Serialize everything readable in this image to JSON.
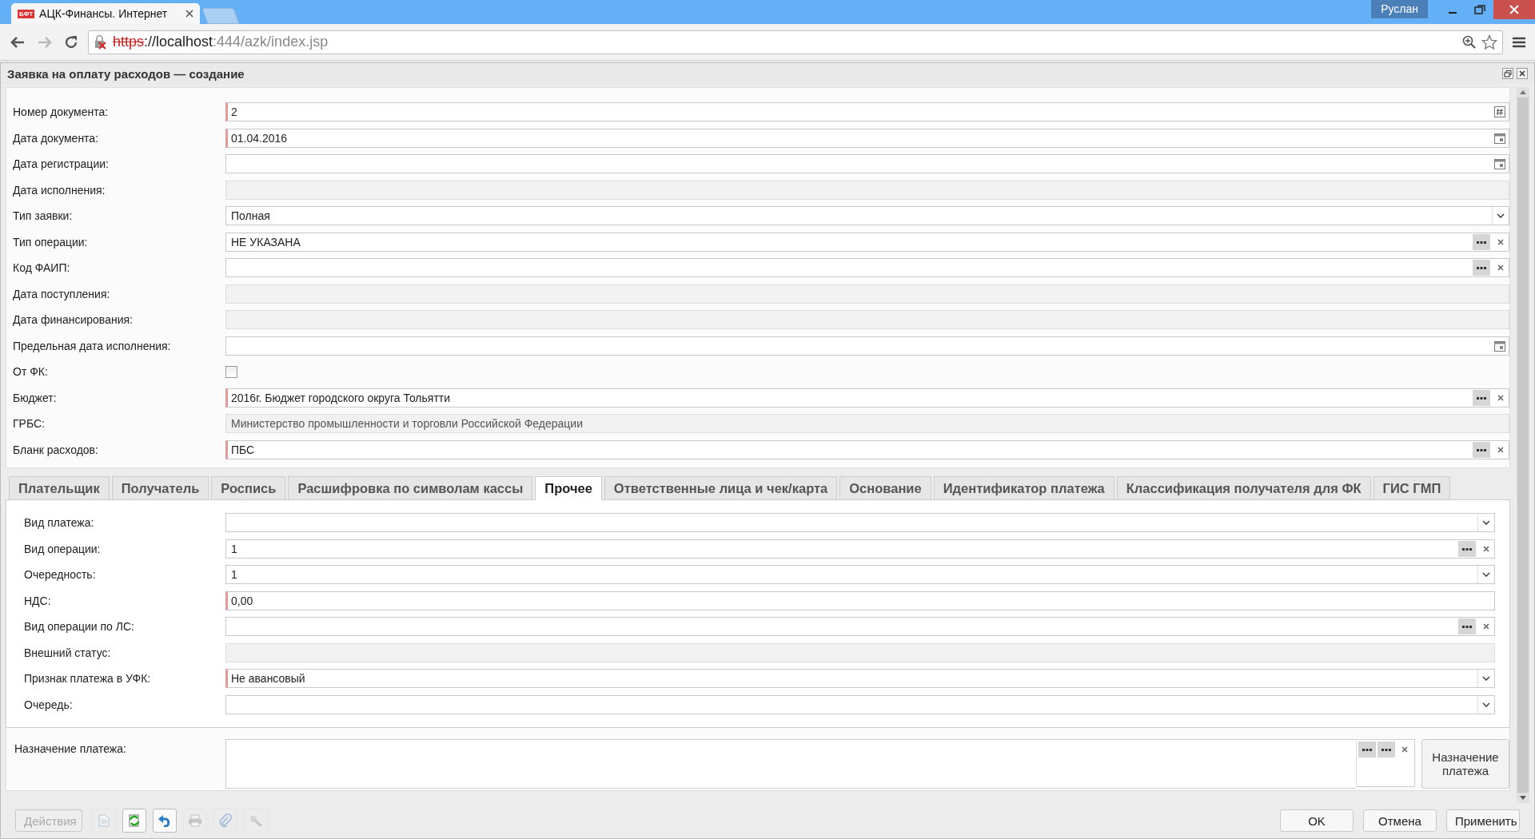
{
  "browser": {
    "tab": {
      "favicon_text": "БФТ",
      "title": "АЦК-Финансы. Интернет"
    },
    "user": "Руслан",
    "url_scheme": "https",
    "url_host": "://localhost",
    "url_path": ":444/azk/index.jsp"
  },
  "window": {
    "title": "Заявка на оплату расходов — создание"
  },
  "form": {
    "fields": [
      {
        "label": "Номер документа:",
        "kind": "number",
        "value": "2",
        "required": true
      },
      {
        "label": "Дата документа:",
        "kind": "date",
        "value": "01.04.2016",
        "required": true
      },
      {
        "label": "Дата регистрации:",
        "kind": "date",
        "required": false
      },
      {
        "label": "Дата исполнения:",
        "kind": "readonly",
        "required": false
      },
      {
        "label": "Тип заявки:",
        "kind": "select",
        "value": "Полная",
        "required": false
      },
      {
        "label": "Тип операции:",
        "kind": "lookup",
        "value": "НЕ УКАЗАНА",
        "required": false
      },
      {
        "label": "Код ФАИП:",
        "kind": "lookup",
        "required": false
      },
      {
        "label": "Дата поступления:",
        "kind": "readonly",
        "required": false
      },
      {
        "label": "Дата финансирования:",
        "kind": "readonly",
        "required": false
      },
      {
        "label": "Предельная дата исполнения:",
        "kind": "date",
        "required": false
      },
      {
        "label": "От ФК:",
        "kind": "checkbox",
        "checked": false
      },
      {
        "label": "Бюджет:",
        "kind": "lookup",
        "value": "2016г. Бюджет городского округа Тольятти",
        "required": true
      },
      {
        "label": "ГРБС:",
        "kind": "readonly",
        "value": "Министерство промышленности и торговли Российской Федерации",
        "required": false
      },
      {
        "label": "Бланк расходов:",
        "kind": "lookup",
        "value": "ПБС",
        "required": true
      }
    ]
  },
  "tabs": [
    {
      "label": "Плательщик",
      "selected": false
    },
    {
      "label": "Получатель",
      "selected": false
    },
    {
      "label": "Роспись",
      "selected": false
    },
    {
      "label": "Расшифровка по символам кассы",
      "selected": false
    },
    {
      "label": "Прочее",
      "selected": true
    },
    {
      "label": "Ответственные лица и чек/карта",
      "selected": false
    },
    {
      "label": "Основание",
      "selected": false
    },
    {
      "label": "Идентификатор платежа",
      "selected": false
    },
    {
      "label": "Классификация получателя для ФК",
      "selected": false
    },
    {
      "label": "ГИС ГМП",
      "selected": false
    }
  ],
  "panel": {
    "fields": [
      {
        "label": "Вид платежа:",
        "kind": "select",
        "required": false
      },
      {
        "label": "Вид операции:",
        "kind": "lookup",
        "value": "1",
        "required": false
      },
      {
        "label": "Очередность:",
        "kind": "select",
        "value": "1",
        "required": false
      },
      {
        "label": "НДС:",
        "kind": "text",
        "value": "0,00",
        "required": true
      },
      {
        "label": "Вид операции по ЛС:",
        "kind": "lookup",
        "required": false
      },
      {
        "label": "Внешний статус:",
        "kind": "readonly",
        "required": false
      },
      {
        "label": "Признак платежа в УФК:",
        "kind": "select",
        "value": "Не авансовый",
        "required": true
      },
      {
        "label": "Очередь:",
        "kind": "select",
        "required": false
      }
    ]
  },
  "purpose": {
    "label": "Назначение платежа:",
    "button": "Назначение платежа"
  },
  "toolbar": [
    {
      "kind": "actions",
      "label": "Действия",
      "disabled": true
    },
    {
      "kind": "document",
      "disabled": true
    },
    {
      "kind": "refresh",
      "disabled": false
    },
    {
      "kind": "undo",
      "disabled": false
    },
    {
      "kind": "print",
      "disabled": true
    },
    {
      "kind": "attach",
      "disabled": true
    },
    {
      "kind": "stamp",
      "disabled": true
    }
  ],
  "buttons": [
    "OK",
    "Отмена",
    "Применить"
  ]
}
